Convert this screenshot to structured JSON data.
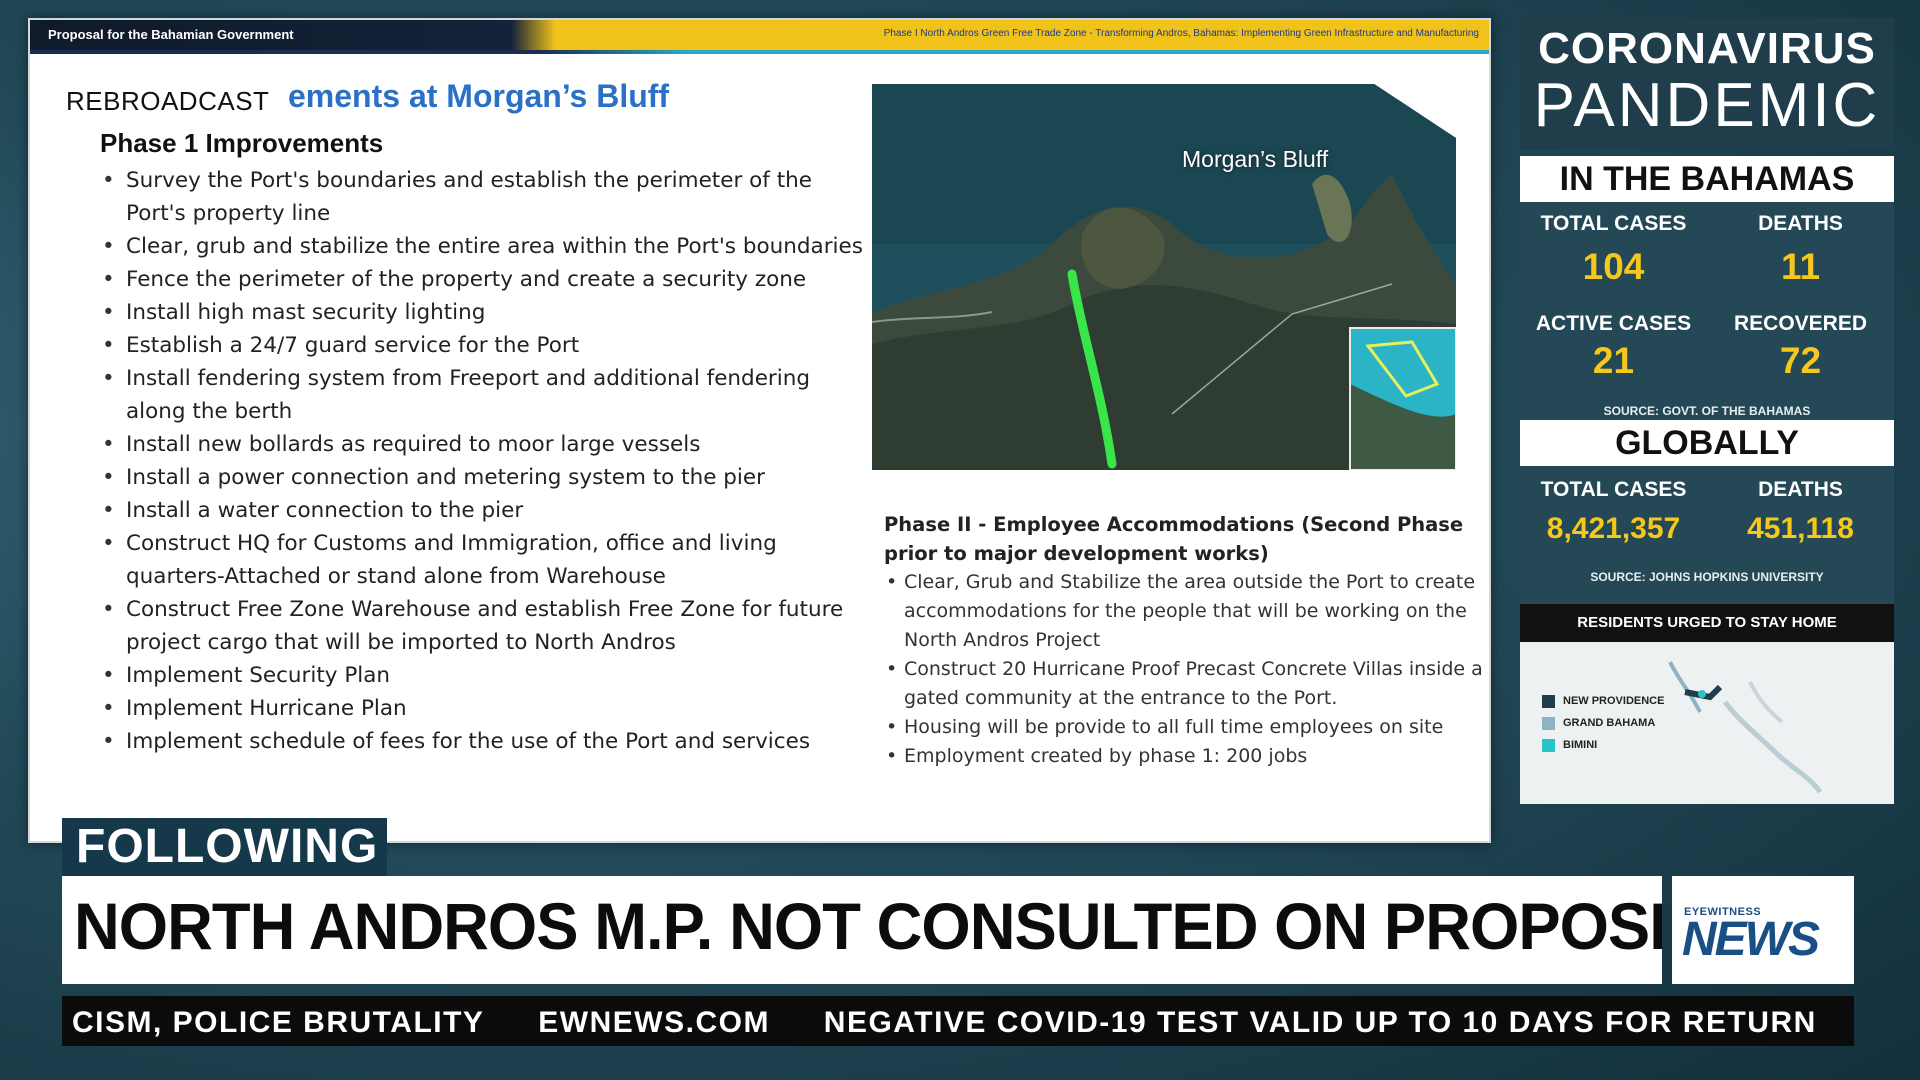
{
  "slide": {
    "header_left": "Proposal for the Bahamian Government",
    "header_right": "Phase I North Andros Green Free Trade Zone - Transforming Andros, Bahamas: Implementing Green Infrastructure and Manufacturing",
    "overlay_label": "REBROADCAST",
    "title": "ements at Morgan’s Bluff",
    "phase1_heading": "Phase 1 Improvements",
    "phase1_items": [
      "Survey the Port's boundaries and establish the perimeter of the Port's property line",
      "Clear, grub and stabilize the entire area within the Port's boundaries",
      "Fence the perimeter of the property and create a security zone",
      "Install high mast security lighting",
      "Establish a 24/7 guard service for the Port",
      "Install fendering system from Freeport and additional fendering along the berth",
      "Install new bollards as required to moor large vessels",
      "Install a power connection and metering system to the pier",
      "Install a water connection to the pier",
      "Construct HQ for Customs and Immigration, office and living quarters-Attached or stand alone from Warehouse",
      "Construct Free Zone Warehouse and establish Free Zone for future project cargo that will be imported to North Andros",
      "Implement Security Plan",
      "Implement Hurricane Plan",
      "Implement schedule of fees for the use of the Port and services"
    ],
    "map_label": "Morgan’s Bluff",
    "phase2_heading": "Phase II - Employee Accommodations (Second Phase prior to major development works)",
    "phase2_items": [
      "Clear, Grub and Stabilize the area outside the Port to create accommodations for the people that will be working on the North Andros Project",
      "Construct 20 Hurricane Proof Precast Concrete Villas inside a gated community at the entrance to the Port.",
      "Housing will be provide to all full time employees on site",
      "Employment created by phase 1: 200 jobs"
    ]
  },
  "panel": {
    "title_line1": "CORONAVIRUS",
    "title_line2": "PANDEMIC",
    "bahamas": {
      "heading": "IN THE BAHAMAS",
      "total_cases_label": "TOTAL CASES",
      "total_cases": "104",
      "deaths_label": "DEATHS",
      "deaths": "11",
      "active_label": "ACTIVE CASES",
      "active": "21",
      "recovered_label": "RECOVERED",
      "recovered": "72",
      "source": "SOURCE: GOVT. OF THE BAHAMAS"
    },
    "global": {
      "heading": "GLOBALLY",
      "total_cases_label": "TOTAL CASES",
      "total_cases": "8,421,357",
      "deaths_label": "DEATHS",
      "deaths": "451,118",
      "source": "SOURCE: JOHNS HOPKINS UNIVERSITY"
    },
    "residents": {
      "heading": "RESIDENTS URGED TO STAY HOME",
      "legend": [
        {
          "label": "NEW PROVIDENCE",
          "color": "#1f3d4a"
        },
        {
          "label": "GRAND BAHAMA",
          "color": "#8fb3c1"
        },
        {
          "label": "BIMINI",
          "color": "#29c4c9"
        }
      ]
    }
  },
  "lower_third": {
    "following": "FOLLOWING",
    "headline": "NORTH ANDROS M.P. NOT CONSULTED ON PROPOSED PROJECTS",
    "logo_small": "EYEWITNESS",
    "logo_big": "NEWS",
    "ticker": [
      "CISM, POLICE BRUTALITY",
      "EWNEWS.COM",
      "NEGATIVE COVID-19 TEST VALID UP TO 10 DAYS FOR RETURN"
    ]
  }
}
